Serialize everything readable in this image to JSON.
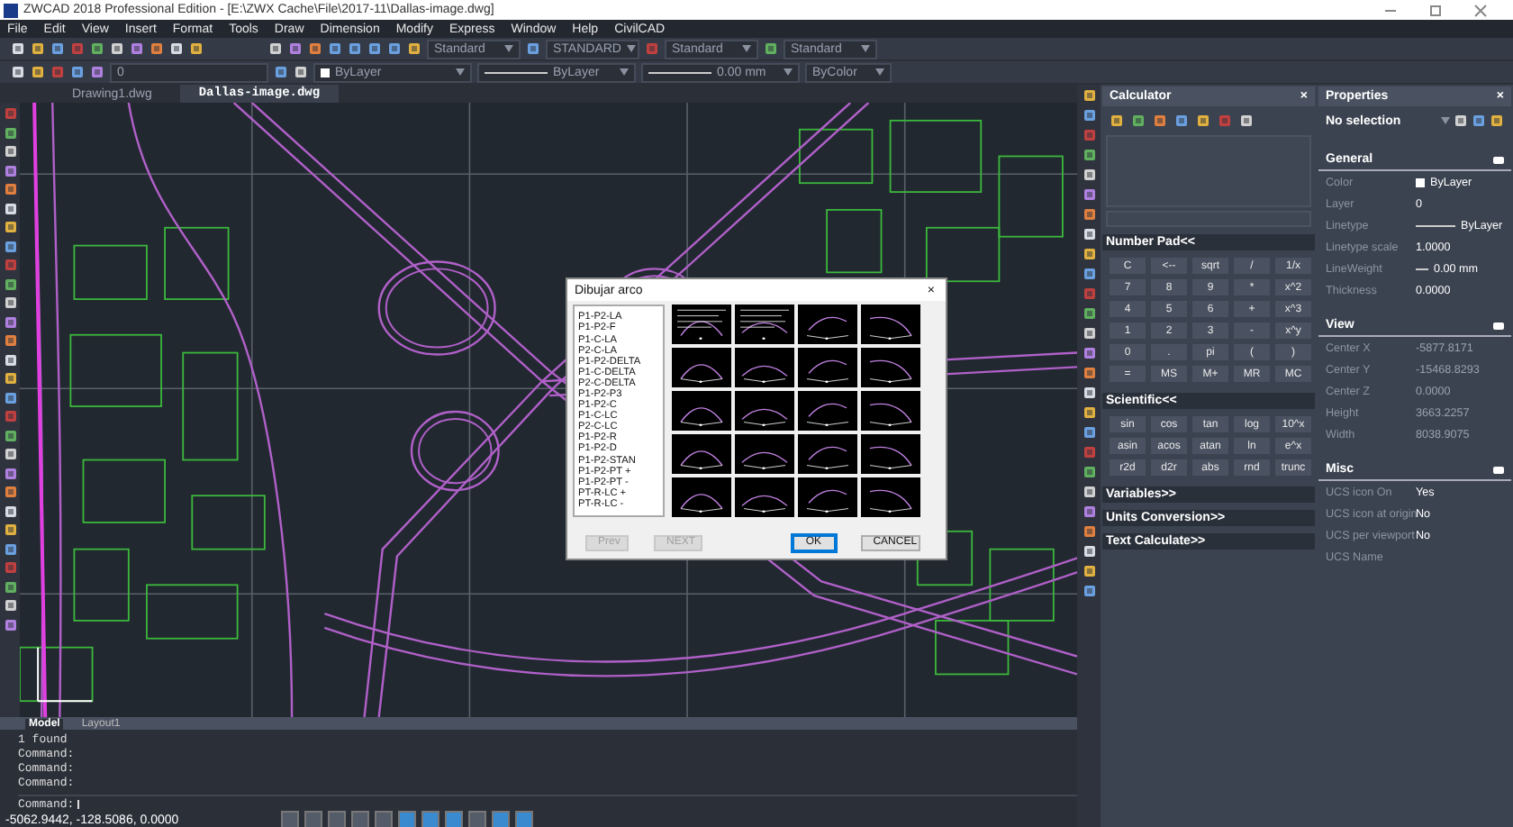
{
  "window": {
    "title": "ZWCAD 2018 Professional Edition - [E:\\ZWX Cache\\File\\2017-11\\Dallas-image.dwg]"
  },
  "menu": [
    "File",
    "Edit",
    "View",
    "Insert",
    "Format",
    "Tools",
    "Draw",
    "Dimension",
    "Modify",
    "Express",
    "Window",
    "Help",
    "CivilCAD"
  ],
  "toolbar_1": {
    "style_dropdowns": [
      "Standard",
      "STANDARD",
      "Standard",
      "Standard"
    ]
  },
  "toolbar_2": {
    "layer": "0",
    "color_setting": "ByLayer",
    "linetype": "ByLayer",
    "lineweight": "0.00 mm",
    "plot_style": "ByColor"
  },
  "doc_tabs": [
    {
      "label": "Drawing1.dwg",
      "selected": false
    },
    {
      "label": "Dallas-image.dwg",
      "selected": true
    }
  ],
  "dialog": {
    "title": "Dibujar arco",
    "close": "×",
    "options": [
      "P1-P2-LA",
      "P1-P2-F",
      "P1-C-LA",
      "P2-C-LA",
      "P1-P2-DELTA",
      "P1-C-DELTA",
      "P2-C-DELTA",
      "P1-P2-P3",
      "P1-P2-C",
      "P1-C-LC",
      "P2-C-LC",
      "P1-P2-R",
      "P1-P2-D",
      "P1-P2-STAN",
      "P1-P2-PT +",
      "P1-P2-PT -",
      "PT-R-LC +",
      "PT-R-LC -"
    ],
    "buttons": [
      {
        "label": "Prev",
        "disabled": true,
        "default": false
      },
      {
        "label": "NEXT",
        "disabled": true,
        "default": false
      },
      {
        "label": "OK",
        "disabled": false,
        "default": true
      },
      {
        "label": "CANCEL",
        "disabled": false,
        "default": false
      }
    ]
  },
  "calculator": {
    "title": "Calculator",
    "close": "×",
    "number_pad": {
      "title": "Number Pad<<",
      "keys": [
        [
          "C",
          "<--",
          "sqrt",
          "/",
          "1/x"
        ],
        [
          "7",
          "8",
          "9",
          "*",
          "x^2"
        ],
        [
          "4",
          "5",
          "6",
          "+",
          "x^3"
        ],
        [
          "1",
          "2",
          "3",
          "-",
          "x^y"
        ],
        [
          "0",
          ".",
          "pi",
          "(",
          ")"
        ],
        [
          "=",
          "MS",
          "M+",
          "MR",
          "MC"
        ]
      ]
    },
    "scientific": {
      "title": "Scientific<<",
      "keys": [
        [
          "sin",
          "cos",
          "tan",
          "log",
          "10^x"
        ],
        [
          "asin",
          "acos",
          "atan",
          "ln",
          "e^x"
        ],
        [
          "r2d",
          "d2r",
          "abs",
          "rnd",
          "trunc"
        ]
      ]
    },
    "collapsed_sections": [
      "Variables>>",
      "Units Conversion>>",
      "Text Calculate>>"
    ]
  },
  "properties": {
    "title": "Properties",
    "close": "×",
    "selection": "No selection",
    "sections": [
      {
        "title": "General",
        "read_only": false,
        "rows": [
          {
            "label": "Color",
            "value": "ByLayer",
            "kind": "swatch"
          },
          {
            "label": "Layer",
            "value": "0",
            "kind": "text"
          },
          {
            "label": "Linetype",
            "value": "ByLayer",
            "kind": "line"
          },
          {
            "label": "Linetype scale",
            "value": "1.0000",
            "kind": "text"
          },
          {
            "label": "LineWeight",
            "value": "0.00 mm",
            "kind": "short-line"
          },
          {
            "label": "Thickness",
            "value": "0.0000",
            "kind": "text"
          }
        ]
      },
      {
        "title": "View",
        "read_only": true,
        "rows": [
          {
            "label": "Center X",
            "value": "-5877.8171",
            "kind": "text"
          },
          {
            "label": "Center Y",
            "value": "-15468.8293",
            "kind": "text"
          },
          {
            "label": "Center Z",
            "value": "0.0000",
            "kind": "text"
          },
          {
            "label": "Height",
            "value": "3663.2257",
            "kind": "text"
          },
          {
            "label": "Width",
            "value": "8038.9075",
            "kind": "text"
          }
        ]
      },
      {
        "title": "Misc",
        "read_only": false,
        "rows": [
          {
            "label": "UCS icon On",
            "value": "Yes",
            "kind": "text"
          },
          {
            "label": "UCS icon at origin",
            "value": "No",
            "kind": "text"
          },
          {
            "label": "UCS per viewport",
            "value": "No",
            "kind": "text"
          },
          {
            "label": "UCS Name",
            "kind": "text"
          }
        ]
      }
    ]
  },
  "layout_tabs": [
    {
      "label": "Model",
      "selected": true
    },
    {
      "label": "Layout1",
      "selected": false
    }
  ],
  "command_history": [
    "1 found",
    "Command:",
    "Command:",
    "Command:"
  ],
  "command_prompt": "Command:",
  "status_bar": {
    "coordinates": "-5062.9442, -128.5086, 0.0000",
    "toggles": [
      {
        "on": false
      },
      {
        "on": false
      },
      {
        "on": false
      },
      {
        "on": false
      },
      {
        "on": false
      },
      {
        "on": true
      },
      {
        "on": true
      },
      {
        "on": true
      },
      {
        "on": false
      },
      {
        "on": true
      },
      {
        "on": true
      }
    ]
  }
}
